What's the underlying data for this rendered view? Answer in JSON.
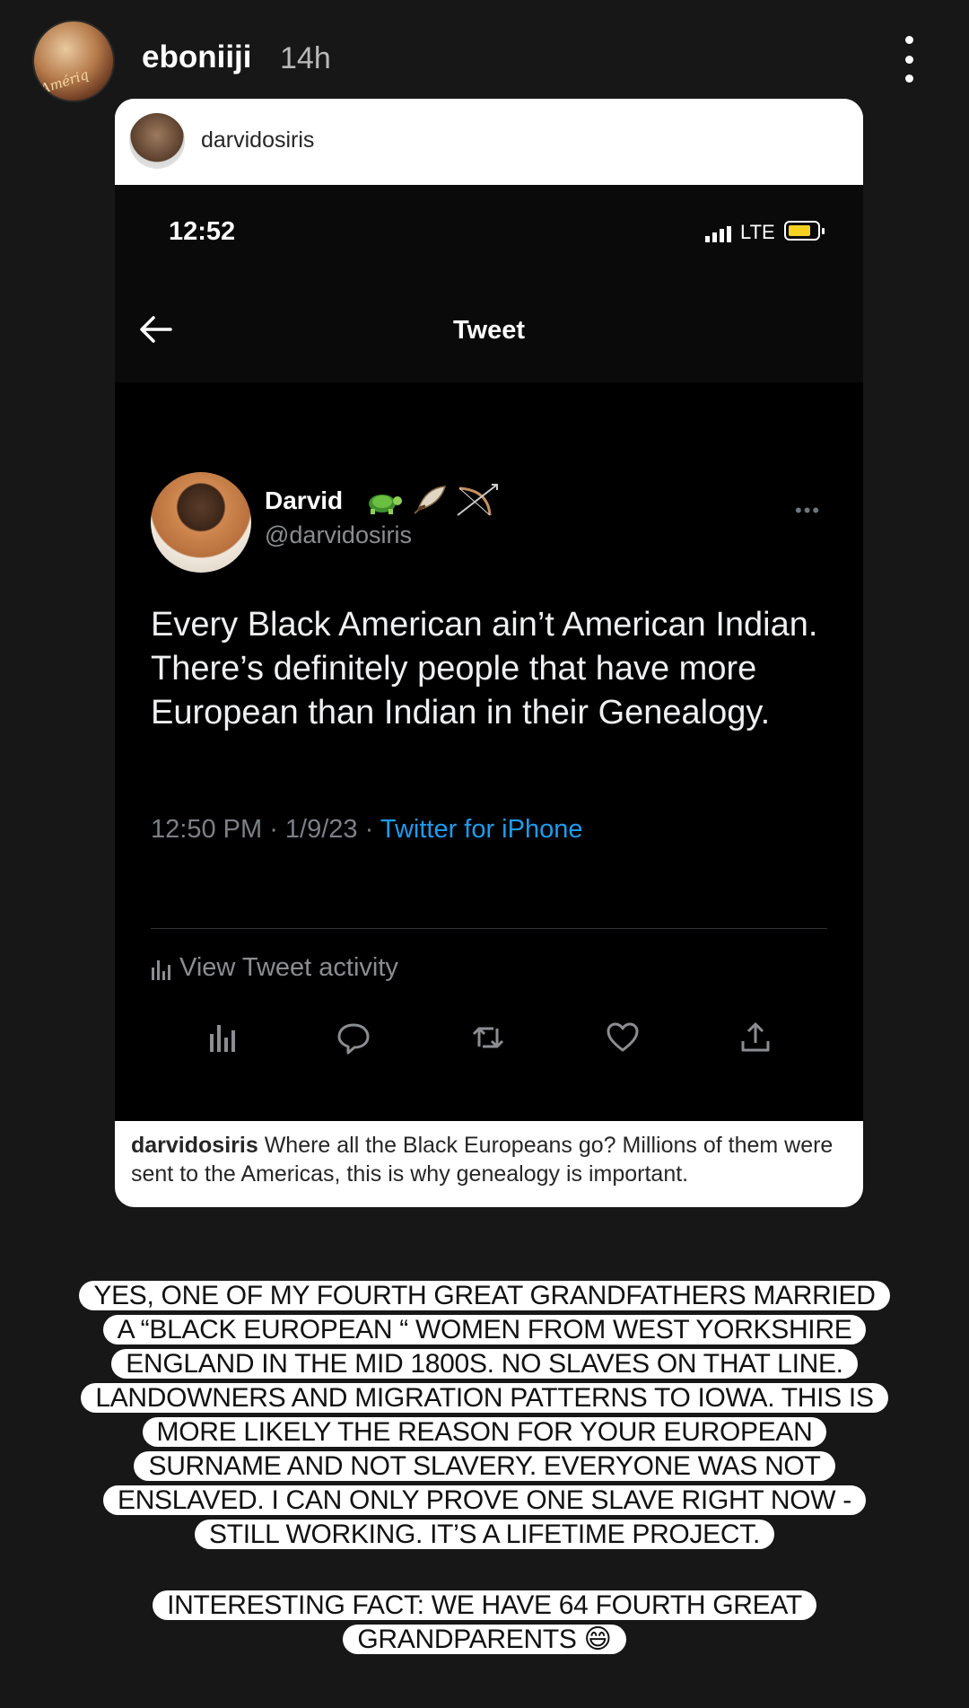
{
  "story": {
    "username": "eboniiji",
    "time": "14h",
    "avatar_text": "Amériq"
  },
  "shared_post": {
    "username": "darvidosiris",
    "caption_user": "darvidosiris",
    "caption_text": "Where all the Black Europeans go? Millions of them were sent to the Americas, this is why genealogy is important."
  },
  "phone": {
    "clock": "12:52",
    "network": "LTE",
    "battery_color": "#f5d221"
  },
  "tweet": {
    "nav_title": "Tweet",
    "display_name": "Darvid",
    "name_emojis": [
      "turtle-icon",
      "feather-icon",
      "bow-and-arrow-icon"
    ],
    "handle": "@darvidosiris",
    "text": "Every Black American ain’t American Indian. There’s definitely people that have more European than Indian in their Genealogy.",
    "time": "12:50 PM",
    "date": "1/9/23",
    "source": "Twitter for iPhone",
    "activity_label": "View Tweet activity",
    "accent_color": "#1d9bf0"
  },
  "overlays": {
    "main_lines": [
      "YES, ONE OF MY FOURTH GREAT GRANDFATHERS MARRIED",
      "A “BLACK EUROPEAN “ WOMEN FROM WEST YORKSHIRE",
      "ENGLAND IN THE MID 1800S. NO SLAVES ON THAT LINE.",
      "LANDOWNERS AND MIGRATION PATTERNS TO IOWA. THIS IS",
      "MORE LIKELY THE REASON FOR YOUR EUROPEAN",
      "SURNAME AND NOT SLAVERY. EVERYONE WAS NOT",
      "ENSLAVED. I CAN ONLY PROVE ONE SLAVE RIGHT NOW -",
      "STILL WORKING. IT’S A LIFETIME PROJECT."
    ],
    "fact_lines": [
      "INTERESTING FACT: WE HAVE 64 FOURTH GREAT",
      "GRANDPARENTS 😄"
    ]
  }
}
